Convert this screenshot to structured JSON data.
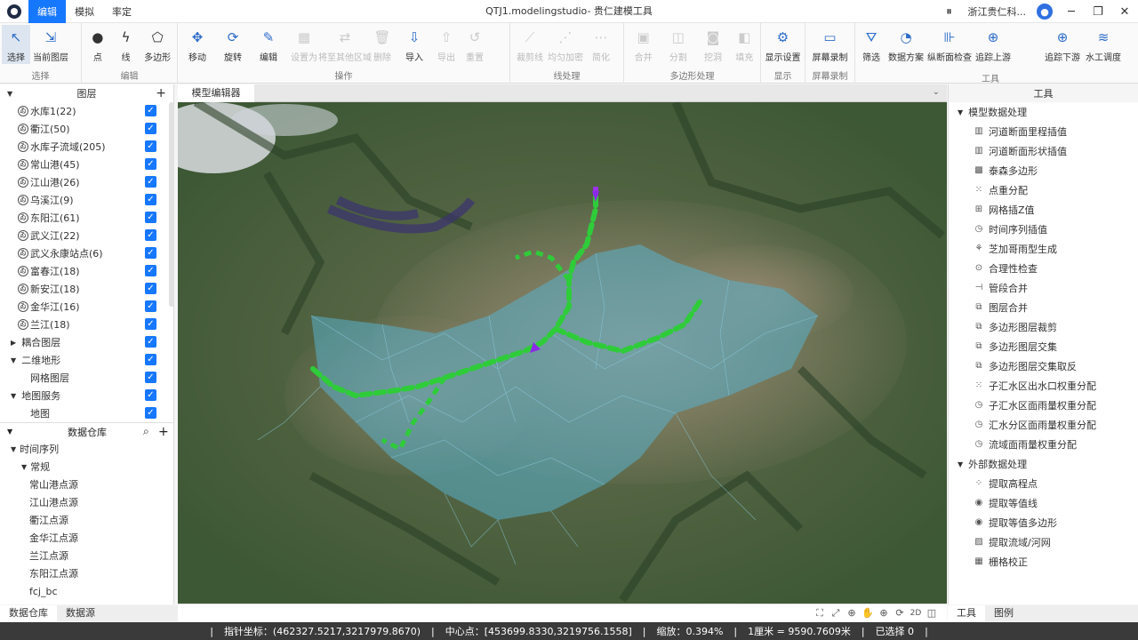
{
  "titlebar": {
    "menus": [
      "编辑",
      "模拟",
      "率定"
    ],
    "window_title": "QTJ1.modelingstudio- 贵仁建模工具",
    "user": "浙江贵仁科...",
    "controls": [
      "─",
      "❐",
      "✕"
    ]
  },
  "ribbon": {
    "groups": [
      {
        "label": "选择",
        "buttons": [
          "选择",
          "当前图层"
        ]
      },
      {
        "label": "编辑",
        "buttons": [
          "点",
          "线",
          "多边形"
        ]
      },
      {
        "label": "操作",
        "buttons": [
          "移动",
          "旋转",
          "编辑",
          "设置为",
          "将至其他区域",
          "删除",
          "导入",
          "导出",
          "重置"
        ]
      },
      {
        "label": "线处理",
        "buttons": [
          "裁剪线",
          "均匀加密",
          "简化"
        ]
      },
      {
        "label": "多边形处理",
        "buttons": [
          "合并",
          "分割",
          "挖洞",
          "填充"
        ]
      },
      {
        "label": "显示",
        "buttons": [
          "显示设置"
        ]
      },
      {
        "label": "屏幕录制",
        "buttons": [
          "屏幕录制"
        ]
      },
      {
        "label": "工具",
        "buttons": [
          "筛选",
          "数据方案",
          "纵断面检查",
          "追踪上游",
          "追踪下游",
          "水工调度"
        ]
      }
    ]
  },
  "layers_panel": {
    "title": "图层",
    "layers": [
      {
        "name": "水库1(22)"
      },
      {
        "name": "衢江(50)"
      },
      {
        "name": "水库子流域(205)"
      },
      {
        "name": "常山港(45)"
      },
      {
        "name": "江山港(26)"
      },
      {
        "name": "乌溪江(9)"
      },
      {
        "name": "东阳江(61)"
      },
      {
        "name": "武义江(22)"
      },
      {
        "name": "武义永康站点(6)"
      },
      {
        "name": "富春江(18)"
      },
      {
        "name": "新安江(18)"
      },
      {
        "name": "金华江(16)"
      },
      {
        "name": "兰江(18)"
      }
    ],
    "groups": [
      {
        "name": "耦合图层",
        "expanded": false
      },
      {
        "name": "二维地形",
        "expanded": true,
        "children": [
          "网格图层"
        ]
      },
      {
        "name": "地图服务",
        "expanded": true,
        "children": [
          "地图"
        ]
      }
    ]
  },
  "database_panel": {
    "title": "数据仓库",
    "root": "时间序列",
    "sub": "常规",
    "items": [
      "常山港点源",
      "江山港点源",
      "衢江点源",
      "金华江点源",
      "兰江点源",
      "东阳江点源",
      "fcj_bc"
    ]
  },
  "left_tabs": [
    "数据仓库",
    "数据源"
  ],
  "editor_tab": "模型编辑器",
  "map_tools": [
    "⛶",
    "⤢",
    "⊕",
    "✋",
    "⊕",
    "⟳",
    "2D",
    "◫"
  ],
  "tools_panel": {
    "title": "工具",
    "group1": "模型数据处理",
    "group1_items": [
      "河道断面里程插值",
      "河道断面形状插值",
      "泰森多边形",
      "点重分配",
      "网格插Z值",
      "时间序列插值",
      "芝加哥雨型生成",
      "合理性检查",
      "管段合并",
      "图层合并",
      "多边形图层裁剪",
      "多边形图层交集",
      "多边形图层交集取反",
      "子汇水区出水口权重分配",
      "子汇水区面雨量权重分配",
      "汇水分区面雨量权重分配",
      "流域面雨量权重分配"
    ],
    "group2": "外部数据处理",
    "group2_items": [
      "提取高程点",
      "提取等值线",
      "提取等值多边形",
      "提取流域/河网",
      "栅格校正"
    ]
  },
  "right_tabs": [
    "工具",
    "图例"
  ],
  "status": {
    "pointer": "指针坐标：(462327.5217,3217979.8670)",
    "center": "中心点：[453699.8330,3219756.1558]",
    "zoom": "缩放：0.394%",
    "scale": "1厘米 = 9590.7609米",
    "selected": "已选择 0"
  }
}
